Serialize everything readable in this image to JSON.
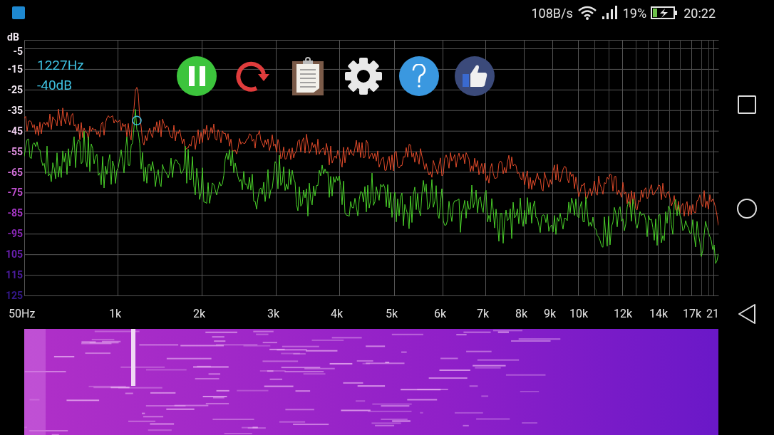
{
  "status_bar": {
    "network_speed": "108B/s",
    "battery_percent": "19%",
    "time": "20:22"
  },
  "readout": {
    "frequency": "1227Hz",
    "level": "-40dB"
  },
  "y_axis": {
    "unit": "dB",
    "labels": [
      "-5",
      "-15",
      "-25",
      "-35",
      "-45",
      "-55",
      "-65",
      "-75",
      "-85",
      "-95",
      "105",
      "115",
      "125"
    ]
  },
  "x_axis": {
    "labels": [
      "50Hz",
      "1k",
      "2k",
      "3k",
      "4k",
      "5k",
      "6k",
      "7k",
      "8k",
      "9k",
      "10k",
      "12k",
      "14k",
      "17k",
      "21"
    ]
  }
}
